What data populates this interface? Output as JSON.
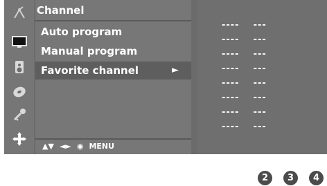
{
  "menu": {
    "title": "Channel",
    "items": [
      {
        "label": "Auto program"
      },
      {
        "label": "Manual program"
      },
      {
        "label": "Favorite channel",
        "arrow": "►"
      }
    ],
    "hint": {
      "updown": "▲▼",
      "leftright": "◄►",
      "ok": "◉",
      "menu": "MENU"
    }
  },
  "favorites": {
    "rows": [
      {
        "a": "----",
        "b": "---"
      },
      {
        "a": "----",
        "b": "---"
      },
      {
        "a": "----",
        "b": "---"
      },
      {
        "a": "----",
        "b": "---"
      },
      {
        "a": "----",
        "b": "---"
      },
      {
        "a": "----",
        "b": "---"
      },
      {
        "a": "----",
        "b": "---"
      },
      {
        "a": "----",
        "b": "---"
      }
    ]
  },
  "badges": [
    "2",
    "3",
    "4"
  ],
  "icons": [
    "antenna-icon",
    "screen-icon",
    "speaker-icon",
    "disc-icon",
    "key-icon",
    "move-icon"
  ],
  "colors": {
    "panel": "#6b6b6b",
    "active": "#5e5e5e",
    "text": "#ffffff",
    "badge": "#4b4b4b"
  }
}
